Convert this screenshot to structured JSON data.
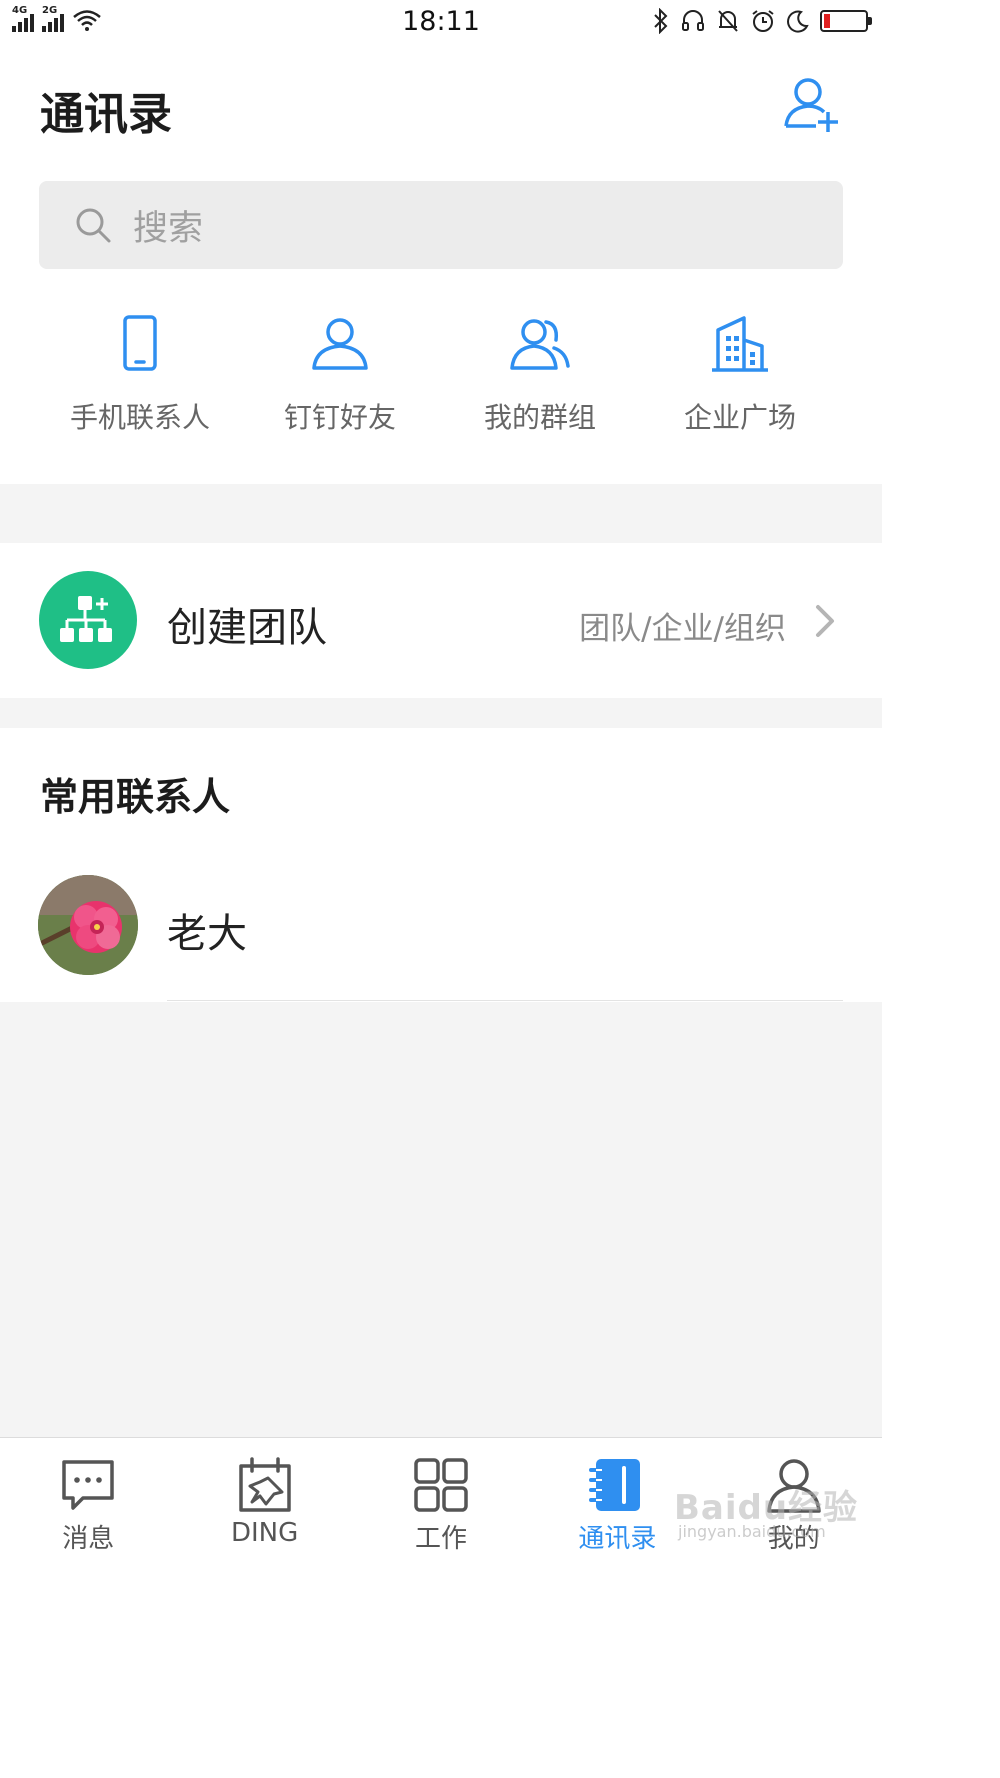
{
  "status_bar": {
    "time": "18:11",
    "signal_1": "4G",
    "signal_2": "2G",
    "icons": [
      "bluetooth-icon",
      "headphones-icon",
      "mute-bell-icon",
      "alarm-icon",
      "moon-icon",
      "battery-icon"
    ],
    "battery_color": "#e02020"
  },
  "header": {
    "title": "通讯录",
    "add_icon": "add-contact-icon"
  },
  "search": {
    "placeholder": "搜索",
    "icon": "search-icon"
  },
  "quick_entries": [
    {
      "label": "手机联系人",
      "icon": "phone-icon"
    },
    {
      "label": "钉钉好友",
      "icon": "person-icon"
    },
    {
      "label": "我的群组",
      "icon": "group-icon"
    },
    {
      "label": "企业广场",
      "icon": "building-icon"
    }
  ],
  "team": {
    "title": "创建团队",
    "subtitle": "团队/企业/组织",
    "icon": "org-chart-icon",
    "icon_bg": "#1fbf86"
  },
  "frequent": {
    "title": "常用联系人",
    "contacts": [
      {
        "name": "老大",
        "avatar": "flower-avatar"
      }
    ]
  },
  "tabs": [
    {
      "label": "消息",
      "icon": "chat-icon",
      "active": false
    },
    {
      "label": "DING",
      "icon": "ding-calendar-icon",
      "active": false
    },
    {
      "label": "工作",
      "icon": "grid-icon",
      "active": false
    },
    {
      "label": "通讯录",
      "icon": "contacts-book-icon",
      "active": true
    },
    {
      "label": "我的",
      "icon": "profile-icon",
      "active": false
    }
  ],
  "watermark": {
    "text": "Baidu经验",
    "subtext": "jingyan.baidu.com"
  },
  "colors": {
    "accent": "#2f8ff0",
    "background": "#f4f4f4"
  }
}
